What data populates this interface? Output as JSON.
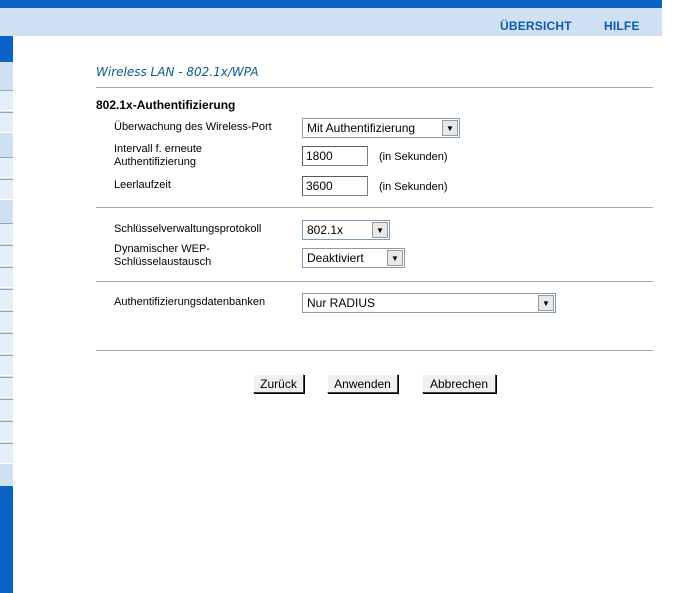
{
  "nav": {
    "overview": "ÜBERSICHT",
    "help": "HILFE"
  },
  "page": {
    "title": "Wireless LAN - 802.1x/WPA"
  },
  "auth_section": {
    "heading": "802.1x-Authentifizierung",
    "port_monitor": {
      "label": "Überwachung des Wireless-Port",
      "value": "Mit Authentifizierung"
    },
    "reauth_interval": {
      "label_line1": "Intervall f. erneute",
      "label_line2": "Authentifizierung",
      "value": "1800",
      "unit": "(in Sekunden)"
    },
    "idle_time": {
      "label": "Leerlaufzeit",
      "value": "3600",
      "unit": "(in Sekunden)"
    }
  },
  "key_section": {
    "protocol": {
      "label": "Schlüsselverwaltungsprotokoll",
      "value": "802.1x"
    },
    "wep_exchange": {
      "label_line1": "Dynamischer WEP-",
      "label_line2": "Schlüsselaustausch",
      "value": "Deaktiviert"
    }
  },
  "db_section": {
    "label": "Authentifizierungsdatenbanken",
    "value": "Nur RADIUS"
  },
  "buttons": {
    "back": "Zurück",
    "apply": "Anwenden",
    "cancel": "Abbrechen"
  },
  "colors": {
    "accent_blue": "#0b63c5",
    "light_blue": "#cfe0f2",
    "title_color": "#0a5d8c"
  }
}
